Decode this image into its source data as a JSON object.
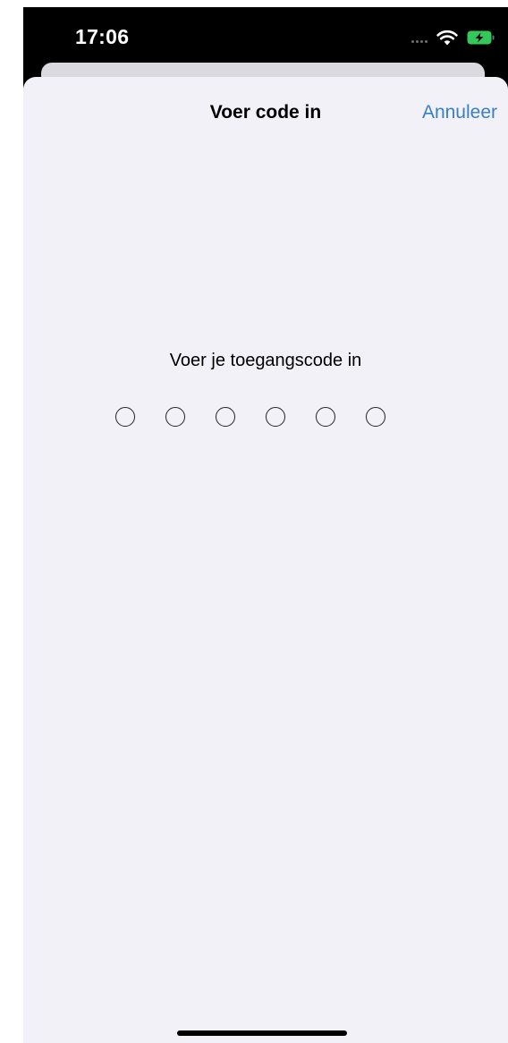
{
  "status_bar": {
    "time": "17:06",
    "icons": [
      "signal-dots-icon",
      "wifi-icon",
      "battery-charging-icon"
    ],
    "battery_color": "#34c759"
  },
  "sheet": {
    "title": "Voer code in",
    "cancel_label": "Annuleer",
    "accent_color": "#3a7fc4"
  },
  "passcode": {
    "prompt": "Voer je toegangscode in",
    "length": 6,
    "entered": 0
  }
}
